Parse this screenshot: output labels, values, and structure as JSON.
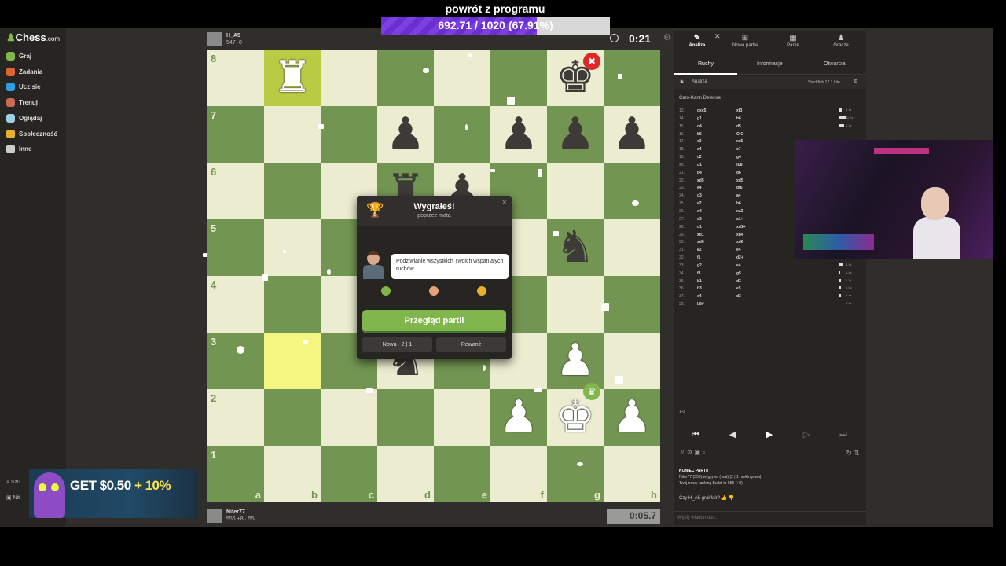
{
  "overlay": {
    "caption": "powrót z programu",
    "progress_text": "692.71 / 1020 (67.91%)",
    "progress_fraction": 0.6791
  },
  "nav": {
    "logo": "Chess",
    "logo_suffix": ".com",
    "items": [
      {
        "label": "Graj",
        "color": "#81b64c"
      },
      {
        "label": "Zadania",
        "color": "#e0642d"
      },
      {
        "label": "Ucz się",
        "color": "#2d9ee0"
      },
      {
        "label": "Trenuj",
        "color": "#c96a54"
      },
      {
        "label": "Oglądaj",
        "color": "#9ecfe6"
      },
      {
        "label": "Społeczność",
        "color": "#e8b02a"
      },
      {
        "label": "Inne",
        "color": "#cccccc"
      }
    ],
    "search_label": "Szu",
    "user_label": "Nit"
  },
  "opponent": {
    "name": "H_A5",
    "rating": "547 -8"
  },
  "player": {
    "name": "Niter77",
    "rating": "556 +8",
    "extra": "55"
  },
  "clocks": {
    "top": "0:21",
    "bottom": "0:05.7"
  },
  "board": {
    "ranks": [
      "8",
      "7",
      "6",
      "5",
      "4",
      "3",
      "2",
      "1"
    ],
    "files": [
      "a",
      "b",
      "c",
      "d",
      "e",
      "f",
      "g",
      "h"
    ],
    "pieces": [
      {
        "sq": "b8",
        "glyph": "♜",
        "color": "w"
      },
      {
        "sq": "g8",
        "glyph": "♚",
        "color": "b"
      },
      {
        "sq": "d7",
        "glyph": "♟",
        "color": "b"
      },
      {
        "sq": "f7",
        "glyph": "♟",
        "color": "b"
      },
      {
        "sq": "g7",
        "glyph": "♟",
        "color": "b"
      },
      {
        "sq": "h7",
        "glyph": "♟",
        "color": "b"
      },
      {
        "sq": "d6",
        "glyph": "♜",
        "color": "b"
      },
      {
        "sq": "e6",
        "glyph": "♟",
        "color": "b"
      },
      {
        "sq": "g5",
        "glyph": "♞",
        "color": "b"
      },
      {
        "sq": "d3",
        "glyph": "♞",
        "color": "b"
      },
      {
        "sq": "g3",
        "glyph": "♟",
        "color": "w"
      },
      {
        "sq": "f2",
        "glyph": "♟",
        "color": "w"
      },
      {
        "sq": "g2",
        "glyph": "♚",
        "color": "w"
      },
      {
        "sq": "h2",
        "glyph": "♟",
        "color": "w"
      }
    ],
    "highlights": [
      "b8",
      "b3"
    ],
    "mate_badge": "✖",
    "win_badge": "♛"
  },
  "modal": {
    "title": "Wygrałeś!",
    "subtitle": "poprzez mata",
    "coach_text": "Podziwianie wszystkich Twoich wspaniałych ruchów...",
    "review_button": "Przegląd partii",
    "new_button": "Nowa - 2 | 1",
    "rematch_button": "Rewanż",
    "close": "×"
  },
  "panel": {
    "tabs": [
      {
        "label": "Analiza",
        "icon": "✎"
      },
      {
        "label": "Nowa partia",
        "icon": "⊞"
      },
      {
        "label": "Partie",
        "icon": "▦"
      },
      {
        "label": "Gracze",
        "icon": "♟"
      }
    ],
    "subtabs": [
      "Ruchy",
      "Informacje",
      "Otwarcia"
    ],
    "analysis_label": "Analiza",
    "engine_label": "Stockfish 17.1 Lite",
    "opening": "Caro-Kann Defense",
    "moves": [
      {
        "n": "13.",
        "w": "dxc5",
        "b": "xf3",
        "bar": 0.4,
        "t": "0.1s"
      },
      {
        "n": "14.",
        "w": "g1",
        "b": "h6",
        "bar": 0.9,
        "t": "11.2s"
      },
      {
        "n": "15.",
        "w": "d4",
        "b": "d5",
        "bar": 0.7,
        "t": "9.2s"
      },
      {
        "n": "16.",
        "w": "b5",
        "b": "O-O",
        "bar": 0,
        "t": ""
      },
      {
        "n": "17.",
        "w": "c3",
        "b": "xc5",
        "bar": 0,
        "t": ""
      },
      {
        "n": "18.",
        "w": "a4",
        "b": "c7",
        "bar": 0,
        "t": ""
      },
      {
        "n": "19.",
        "w": "c2",
        "b": "g4",
        "bar": 0,
        "t": ""
      },
      {
        "n": "20.",
        "w": "d1",
        "b": "fb8",
        "bar": 0,
        "t": ""
      },
      {
        "n": "21.",
        "w": "b4",
        "b": "d6",
        "bar": 0,
        "t": ""
      },
      {
        "n": "22.",
        "w": "xd5",
        "b": "xd5",
        "bar": 0,
        "t": ""
      },
      {
        "n": "23.",
        "w": "e4",
        "b": "gf6",
        "bar": 0,
        "t": ""
      },
      {
        "n": "24.",
        "w": "d3",
        "b": "a4",
        "bar": 0,
        "t": ""
      },
      {
        "n": "25.",
        "w": "e2",
        "b": "b6",
        "bar": 0,
        "t": ""
      },
      {
        "n": "26.",
        "w": "d4",
        "b": "xa3",
        "bar": 0.2,
        "t": "1.8s"
      },
      {
        "n": "27.",
        "w": "d3",
        "b": "a1+",
        "bar": 0.2,
        "t": "1.4s"
      },
      {
        "n": "28.",
        "w": "d1",
        "b": "xd1+",
        "bar": 0.2,
        "t": "1.2s"
      },
      {
        "n": "29.",
        "w": "xd1",
        "b": "xb4",
        "bar": 0.2,
        "t": "1.1s"
      },
      {
        "n": "30.",
        "w": "xd6",
        "b": "xd6",
        "bar": 0.5,
        "t": "4.1s"
      },
      {
        "n": "31.",
        "w": "e2",
        "b": "e4",
        "bar": 0.2,
        "t": "1.4s"
      },
      {
        "n": "32.",
        "w": "f1",
        "b": "d2+",
        "bar": 0.2,
        "t": "1.1s"
      },
      {
        "n": "33.",
        "w": "g2",
        "b": "e4",
        "bar": 0.6,
        "t": "8.9s"
      },
      {
        "n": "34.",
        "w": "f3",
        "b": "g5",
        "bar": 0.2,
        "t": "1.4s"
      },
      {
        "n": "35.",
        "w": "b1",
        "b": "d3",
        "bar": 0.3,
        "t": "1.7s"
      },
      {
        "n": "36.",
        "w": "b3",
        "b": "e5",
        "bar": 0.3,
        "t": "2.0s"
      },
      {
        "n": "37.",
        "w": "e4",
        "b": "d3",
        "bar": 0.3,
        "t": "2.4s"
      },
      {
        "n": "38.",
        "w": "b8#",
        "b": "",
        "bar": 0.1,
        "t": "1.1s"
      }
    ],
    "result": "1-0",
    "log": [
      "KONIEC PARTII",
      "Niter77 (556) wygrywa (mat) (2 | 1 rankingowa)",
      "Twój nowy ranking Bullet to 556 (+8)."
    ],
    "fair_question": "Czy H_A5 grał fair?",
    "chat_placeholder": "Wyślij wiadomość..."
  },
  "promo": {
    "text1": "GET $0.50",
    "text2": "+ 10%"
  }
}
